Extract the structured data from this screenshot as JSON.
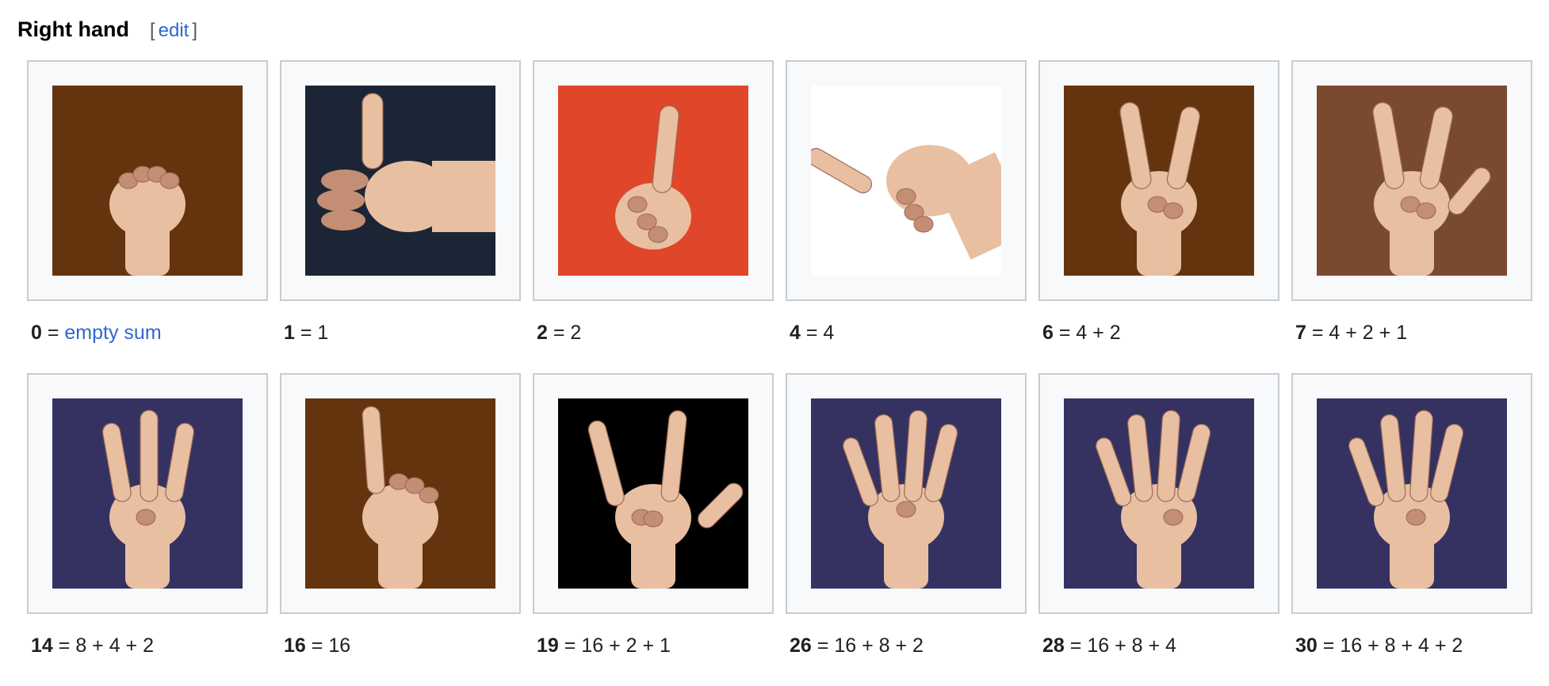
{
  "section": {
    "title": "Right hand",
    "edit_open": "[",
    "edit_label": "edit",
    "edit_close": "]"
  },
  "items": [
    {
      "number": "0",
      "equals": "=",
      "expr": "",
      "link": "empty sum",
      "bg": "#64340f",
      "image": "closed fist"
    },
    {
      "number": "1",
      "equals": "=",
      "expr": "1",
      "link": "",
      "bg": "#1c2535",
      "image": "thumb extended"
    },
    {
      "number": "2",
      "equals": "=",
      "expr": "2",
      "link": "",
      "bg": "#e0462a",
      "image": "index finger raised"
    },
    {
      "number": "4",
      "equals": "=",
      "expr": "4",
      "link": "",
      "bg": "#ffffff",
      "image": "middle finger extended"
    },
    {
      "number": "6",
      "equals": "=",
      "expr": "4 + 2",
      "link": "",
      "bg": "#64340f",
      "image": "index and middle fingers"
    },
    {
      "number": "7",
      "equals": "=",
      "expr": "4 + 2 + 1",
      "link": "",
      "bg": "#7a4a2e",
      "image": "thumb, index and middle fingers"
    },
    {
      "number": "14",
      "equals": "=",
      "expr": "8 + 4 + 2",
      "link": "",
      "bg": "#353262",
      "image": "three middle fingers"
    },
    {
      "number": "16",
      "equals": "=",
      "expr": "16",
      "link": "",
      "bg": "#64340f",
      "image": "little finger raised"
    },
    {
      "number": "19",
      "equals": "=",
      "expr": "16 + 2 + 1",
      "link": "",
      "bg": "#000000",
      "image": "thumb, index and little fingers"
    },
    {
      "number": "26",
      "equals": "=",
      "expr": "16 + 8 + 2",
      "link": "",
      "bg": "#353262",
      "image": "index, ring and little fingers"
    },
    {
      "number": "28",
      "equals": "=",
      "expr": "16 + 8 + 4",
      "link": "",
      "bg": "#353262",
      "image": "middle, ring and little fingers"
    },
    {
      "number": "30",
      "equals": "=",
      "expr": "16 + 8 + 4 + 2",
      "link": "",
      "bg": "#353262",
      "image": "four fingers raised"
    }
  ]
}
